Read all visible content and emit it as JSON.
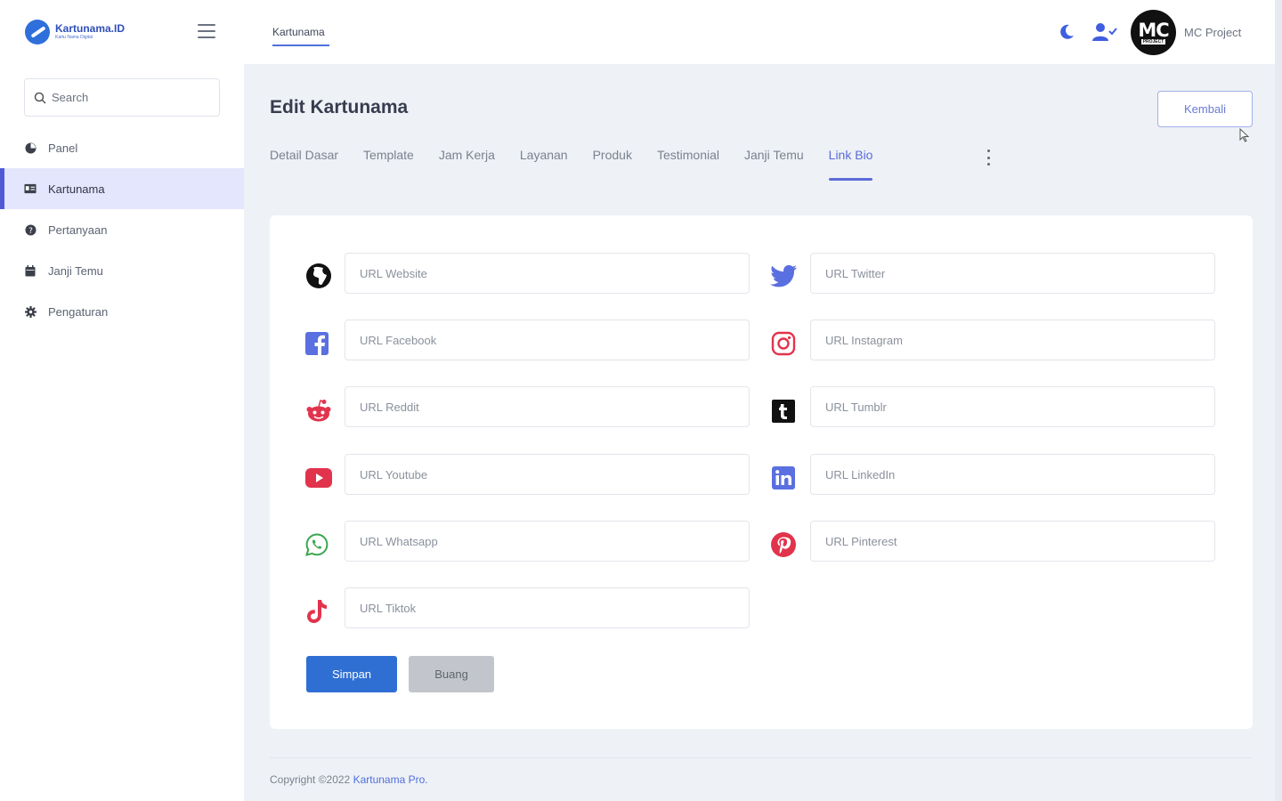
{
  "brand": {
    "name": "Kartunama.ID",
    "tagline": "Kartu Nama Digital"
  },
  "search": {
    "placeholder": "Search"
  },
  "sidebar": {
    "items": [
      {
        "label": "Panel",
        "icon": "dashboard-icon"
      },
      {
        "label": "Kartunama",
        "icon": "id-card-icon",
        "active": true
      },
      {
        "label": "Pertanyaan",
        "icon": "question-icon"
      },
      {
        "label": "Janji Temu",
        "icon": "calendar-icon"
      },
      {
        "label": "Pengaturan",
        "icon": "gear-icon"
      }
    ]
  },
  "header": {
    "tab": "Kartunama",
    "user_name": "MC Project",
    "avatar_text": "MC",
    "avatar_sub": "PROJECT"
  },
  "page": {
    "title": "Edit Kartunama",
    "back_label": "Kembali",
    "tabs": [
      "Detail Dasar",
      "Template",
      "Jam Kerja",
      "Layanan",
      "Produk",
      "Testimonial",
      "Janji Temu",
      "Link Bio"
    ],
    "active_tab": "Link Bio"
  },
  "form": {
    "fields": [
      {
        "placeholder": "URL Website",
        "icon": "globe-icon",
        "value": ""
      },
      {
        "placeholder": "URL Twitter",
        "icon": "twitter-icon",
        "value": ""
      },
      {
        "placeholder": "URL Facebook",
        "icon": "facebook-icon",
        "value": ""
      },
      {
        "placeholder": "URL Instagram",
        "icon": "instagram-icon",
        "value": ""
      },
      {
        "placeholder": "URL Reddit",
        "icon": "reddit-icon",
        "value": ""
      },
      {
        "placeholder": "URL Tumblr",
        "icon": "tumblr-icon",
        "value": ""
      },
      {
        "placeholder": "URL Youtube",
        "icon": "youtube-icon",
        "value": ""
      },
      {
        "placeholder": "URL LinkedIn",
        "icon": "linkedin-icon",
        "value": ""
      },
      {
        "placeholder": "URL Whatsapp",
        "icon": "whatsapp-icon",
        "value": ""
      },
      {
        "placeholder": "URL Pinterest",
        "icon": "pinterest-icon",
        "value": ""
      },
      {
        "placeholder": "URL Tiktok",
        "icon": "tiktok-icon",
        "value": ""
      }
    ],
    "save_label": "Simpan",
    "discard_label": "Buang"
  },
  "footer": {
    "copyright": "Copyright ©2022",
    "link": "Kartunama Pro."
  },
  "colors": {
    "accent": "#4f5bd5",
    "primary_button": "#2f6fd3",
    "sidebar_active_bg": "#e3e6fc",
    "twitter": "#5a6fe0",
    "facebook": "#5a6fe0",
    "instagram": "#e2334d",
    "reddit": "#e2334d",
    "youtube": "#e2334d",
    "linkedin": "#5a6fe0",
    "whatsapp": "#3aa64f",
    "pinterest": "#e2334d",
    "tiktok": "#e2334d"
  }
}
